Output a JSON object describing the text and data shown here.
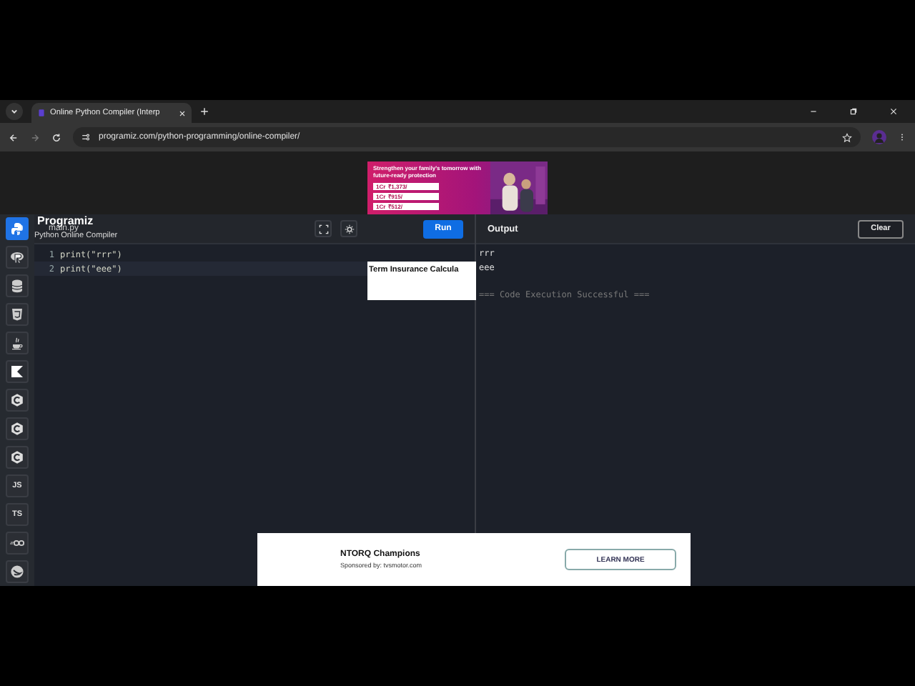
{
  "browser": {
    "tab": {
      "title": "Online Python Compiler (Interp",
      "selected": true
    },
    "url": "programiz.com/python-programming/online-compiler/",
    "forward_disabled": true
  },
  "sidebar": {
    "items": [
      {
        "kind": "python",
        "selected": true
      },
      {
        "kind": "r",
        "selected": false
      },
      {
        "kind": "database",
        "selected": false
      },
      {
        "kind": "html",
        "selected": false
      },
      {
        "kind": "java",
        "selected": false
      },
      {
        "kind": "kotlin",
        "selected": false
      },
      {
        "kind": "c",
        "selected": false
      },
      {
        "kind": "c",
        "selected": false
      },
      {
        "kind": "c",
        "selected": false
      },
      {
        "kind": "text",
        "label": "JS",
        "selected": false
      },
      {
        "kind": "text",
        "label": "TS",
        "selected": false
      },
      {
        "kind": "go",
        "selected": false
      },
      {
        "kind": "swift",
        "selected": false
      }
    ]
  },
  "editor": {
    "logo": "Programiz",
    "file": "main.py",
    "subtitle": "Python Online Compiler",
    "run": "Run",
    "lines": [
      {
        "number": "1",
        "code": "print(\"rrr\")",
        "active": false
      },
      {
        "number": "2",
        "code": "print(\"eee\")",
        "active": true
      }
    ]
  },
  "output": {
    "title": "Output",
    "clear": "Clear",
    "lines": [
      {
        "text": "rrr",
        "kind": "out"
      },
      {
        "text": "eee",
        "kind": "out"
      },
      {
        "text": "=== Code Execution Successful ===",
        "kind": "status"
      }
    ]
  },
  "ad_top": {
    "headline": "Strengthen your family's tomorrow with future-ready protection",
    "rows": [
      {
        "cover": "1Cr",
        "price": "₹1,373/"
      },
      {
        "cover": "1Cr",
        "price": "₹915/"
      },
      {
        "cover": "1Cr",
        "price": "₹512/"
      }
    ],
    "card_title": "Term Insurance Calcula"
  },
  "ad_bottom": {
    "title": "NTORQ Champions",
    "sponsor": "Sponsored by: tvsmotor.com",
    "button": "LEARN MORE"
  }
}
